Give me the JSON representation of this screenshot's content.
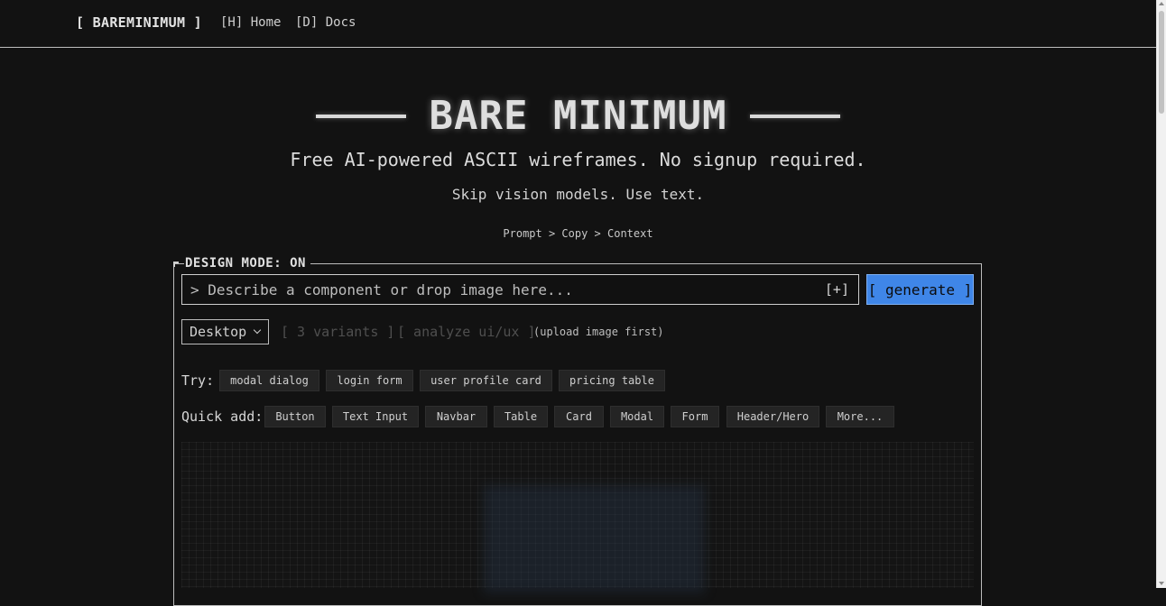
{
  "nav": {
    "brand": "[ BAREMINIMUM ]",
    "links": [
      {
        "label": "[H] Home"
      },
      {
        "label": "[D] Docs"
      }
    ]
  },
  "hero": {
    "title": "BARE MINIMUM",
    "tagline": "Free AI-powered ASCII wireframes. No signup required.",
    "subline": "Skip vision models. Use text.",
    "flow": "Prompt > Copy > Context"
  },
  "panel": {
    "legend": "DESIGN MODE: ON",
    "prompt_placeholder": "> Describe a component or drop image here...",
    "attach_label": "[+]",
    "generate_label": "[ generate ]",
    "device_select": "Desktop",
    "variants_label": "[ 3 variants ]",
    "analyze_label": "[ analyze ui/ux ]",
    "upload_hint": "(upload image first)",
    "try_label": "Try:",
    "try_chips": [
      "modal dialog",
      "login form",
      "user profile card",
      "pricing table"
    ],
    "quick_label": "Quick add:",
    "quick_chips": [
      "Button",
      "Text Input",
      "Navbar",
      "Table",
      "Card",
      "Modal",
      "Form",
      "Header/Hero",
      "More..."
    ]
  },
  "colors": {
    "background": "#121212",
    "accent": "#3f86e8",
    "chip_bg": "#242424"
  }
}
